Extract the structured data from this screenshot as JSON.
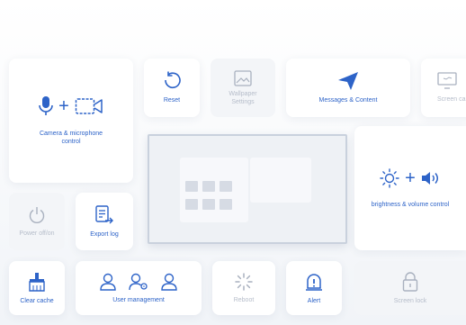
{
  "tiles": {
    "camera_mic": "Camera & microphone control",
    "reset": "Reset",
    "wallpaper": "Wallpaper Settings",
    "messages": "Messages & Content",
    "screen_cast": "Screen ca",
    "brightness_volume": "brightness & volume control",
    "power": "Power off/on",
    "export_log": "Export log",
    "clear_cache": "Clear cache",
    "user_management": "User management",
    "reboot": "Reboot",
    "alert": "Alert",
    "screen_lock": "Screen lock"
  },
  "colors": {
    "accent": "#2d63c8",
    "dim_text": "#b6bdca",
    "dim_icon": "#a9b1bf"
  }
}
